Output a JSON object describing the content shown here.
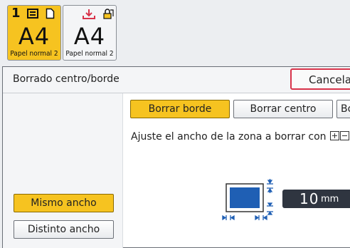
{
  "trays": [
    {
      "number": "1",
      "size": "A4",
      "paper_type": "Papel normal 2",
      "selected": true,
      "icons": [
        "stack-icon",
        "sheet-icon"
      ]
    },
    {
      "number": "",
      "size": "A4",
      "paper_type": "Papel normal 2",
      "selected": false,
      "icons": [
        "bypass-tray-icon",
        "lock-icon"
      ]
    }
  ],
  "panel": {
    "title": "Borrado centro/borde",
    "cancel_label": "Cancelar",
    "tabs": [
      {
        "label": "Borrar borde",
        "selected": true
      },
      {
        "label": "Borrar centro",
        "selected": false
      },
      {
        "label": "Bo",
        "selected": false
      }
    ],
    "instruction": "Ajuste el ancho de la zona a borrar con",
    "same_width_label": "Mismo ancho",
    "different_width_label": "Distinto ancho",
    "value": "10",
    "unit": "mm"
  },
  "colors": {
    "selected": "#f6c320",
    "cancel_border": "#d8334a",
    "page_preview": "#1f5fb4",
    "arrow": "#1f5fb4",
    "value_bg": "#2f3540"
  }
}
